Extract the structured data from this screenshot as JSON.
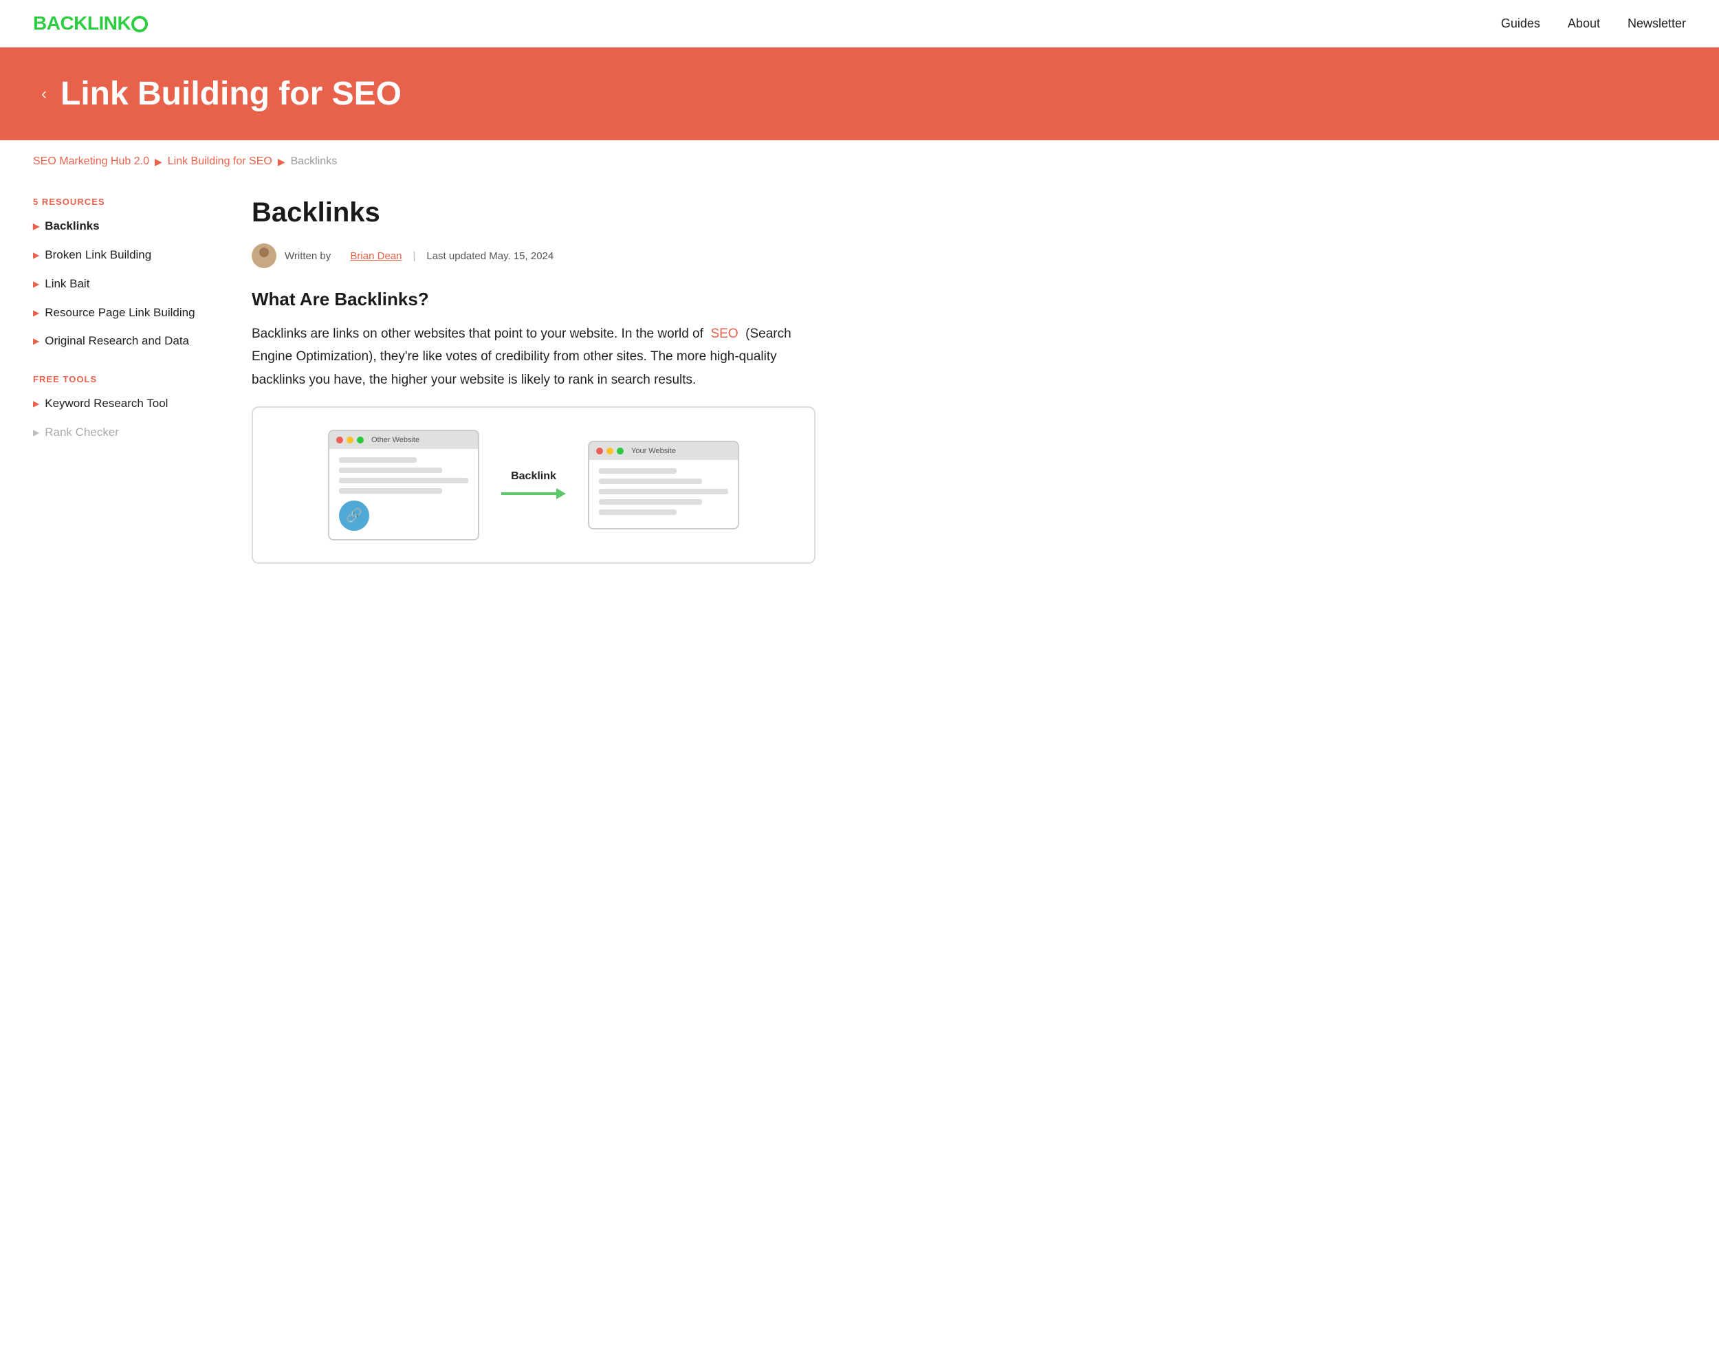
{
  "header": {
    "logo_text": "BACKLINK",
    "nav_items": [
      "Guides",
      "About",
      "Newsletter"
    ]
  },
  "hero": {
    "back_arrow": "‹",
    "title": "Link Building for SEO"
  },
  "breadcrumb": {
    "items": [
      {
        "label": "SEO Marketing Hub 2.0",
        "href": "#"
      },
      {
        "label": "Link Building for SEO",
        "href": "#"
      },
      {
        "label": "Backlinks",
        "current": true
      }
    ]
  },
  "sidebar": {
    "resources_label": "5 RESOURCES",
    "resources": [
      {
        "label": "Backlinks",
        "active": true
      },
      {
        "label": "Broken Link Building",
        "active": false
      },
      {
        "label": "Link Bait",
        "active": false
      },
      {
        "label": "Resource Page Link Building",
        "active": false
      },
      {
        "label": "Original Research and Data",
        "active": false
      }
    ],
    "free_tools_label": "FREE TOOLS",
    "free_tools": [
      {
        "label": "Keyword Research Tool",
        "active": false
      },
      {
        "label": "Rank Checker",
        "active": false,
        "gray": true
      }
    ]
  },
  "content": {
    "page_title": "Backlinks",
    "author_text": "Written by",
    "author_name": "Brian Dean",
    "author_sep": "|",
    "last_updated": "Last updated May. 15, 2024",
    "section1_heading": "What Are Backlinks?",
    "section1_body1": "Backlinks are links on other websites that point to your website. In the world of",
    "section1_seo_link": "SEO",
    "section1_body2": "(Search Engine Optimization), they're like votes of credibility from other sites. The more high-quality backlinks you have, the higher your website is likely to rank in search results.",
    "diagram": {
      "other_website_label": "Other Website",
      "your_website_label": "Your Website",
      "backlink_label": "Backlink",
      "link_icon": "🔗"
    }
  }
}
